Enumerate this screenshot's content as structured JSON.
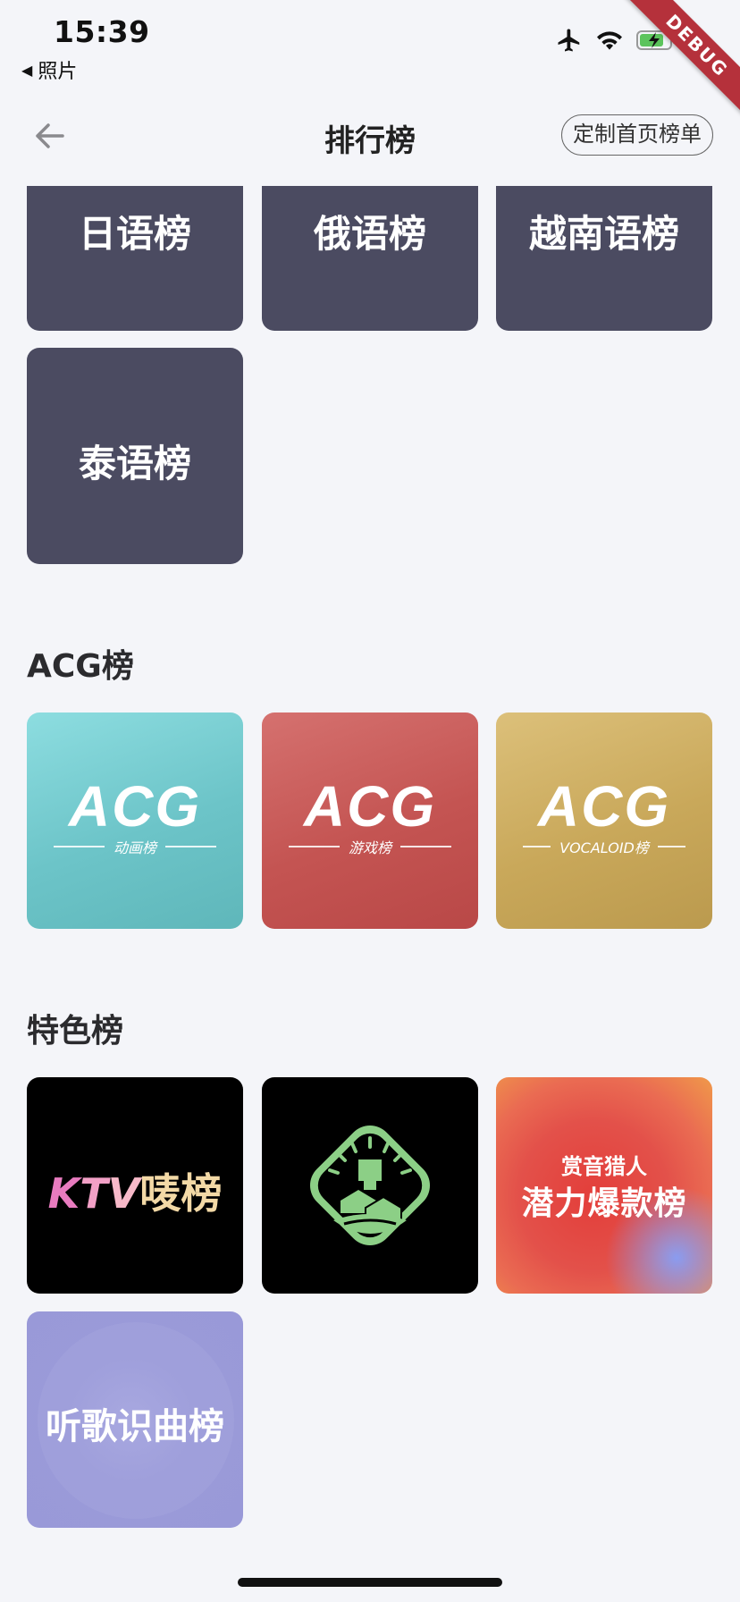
{
  "status_bar": {
    "time": "15:39",
    "back_app": "照片",
    "back_icon": "◀",
    "debug": "DEBUG"
  },
  "nav": {
    "title": "排行榜",
    "customize_label": "定制首页榜单"
  },
  "language_charts": {
    "items": [
      {
        "label": "日语榜"
      },
      {
        "label": "俄语榜"
      },
      {
        "label": "越南语榜"
      },
      {
        "label": "泰语榜"
      }
    ]
  },
  "acg_section": {
    "title": "ACG榜",
    "logo_text": "ACG",
    "items": [
      {
        "subtitle": "动画榜",
        "color": "#6cc4c8"
      },
      {
        "subtitle": "游戏榜",
        "color": "#c45452"
      },
      {
        "subtitle": "VOCALOID榜",
        "color": "#c9a85a"
      }
    ]
  },
  "featured_section": {
    "title": "特色榜",
    "ktv": {
      "k": "K",
      "t": "T",
      "v": "V",
      "cn": "唛榜"
    },
    "hunter": {
      "top": "赏音猎人",
      "main": "潜力爆款榜"
    },
    "listen": {
      "label": "听歌识曲榜"
    }
  }
}
